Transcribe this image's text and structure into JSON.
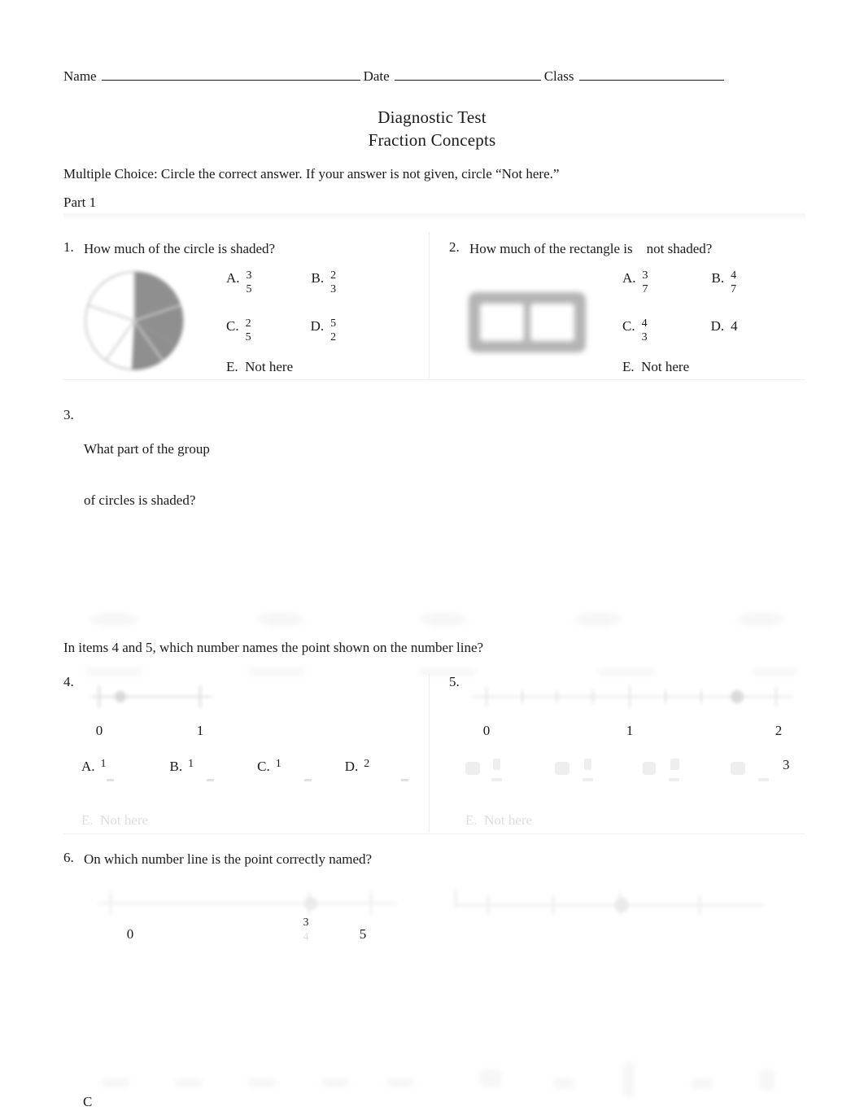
{
  "header": {
    "name_label": "Name",
    "date_label": "Date",
    "class_label": "Class"
  },
  "title": {
    "line1": "Diagnostic Test",
    "line2": "Fraction Concepts"
  },
  "instructions": "Multiple Choice: Circle the correct answer. If your answer is not given, circle “Not here.”",
  "part_label": "Part 1",
  "questions": [
    {
      "number": "1.",
      "text": "How much of the circle is shaded?",
      "figure": "circle-fifths-two-shaded",
      "choices": [
        {
          "letter": "A.",
          "num": "3",
          "den": "5"
        },
        {
          "letter": "B.",
          "num": "2",
          "den": "3"
        },
        {
          "letter": "C.",
          "num": "2",
          "den": "5"
        },
        {
          "letter": "D.",
          "num": "5",
          "den": "2"
        }
      ],
      "not_here": "E.  Not here"
    },
    {
      "number": "2.",
      "text": "How much of the rectangle is    not shaded?",
      "figure": "rectangle-two-cells",
      "choices": [
        {
          "letter": "A.",
          "num": "3",
          "den": "7"
        },
        {
          "letter": "B.",
          "num": "4",
          "den": "7"
        },
        {
          "letter": "C.",
          "num": "4",
          "den": "3"
        },
        {
          "letter": "D.",
          "num": "4",
          "den": ""
        }
      ],
      "not_here": "E.  Not here"
    },
    {
      "number": "3.",
      "text_line1": "What part of the group",
      "text_line2": "of circles is shaded?",
      "figure": "group-of-circles"
    }
  ],
  "numberline_prompt": "In items 4 and 5, which number names the point shown on the number line?",
  "question4": {
    "number": "4.",
    "axis_labels": [
      "0",
      "1"
    ],
    "choices": [
      {
        "letter": "A.",
        "num": "1",
        "den": ""
      },
      {
        "letter": "B.",
        "num": "1",
        "den": ""
      },
      {
        "letter": "C.",
        "num": "1",
        "den": ""
      },
      {
        "letter": "D.",
        "num": "2",
        "den": ""
      }
    ],
    "not_here": "E.  Not here"
  },
  "question5": {
    "number": "5.",
    "axis_labels": [
      "0",
      "1",
      "2"
    ],
    "choices": [
      {
        "letter": "",
        "num": "",
        "den": ""
      },
      {
        "letter": "",
        "num": "",
        "den": ""
      },
      {
        "letter": "",
        "num": "",
        "den": ""
      },
      {
        "letter": "",
        "num": "3",
        "den": ""
      }
    ],
    "not_here": "E.  Not here"
  },
  "question6": {
    "number": "6.",
    "text": "On which number line is the point correctly named?",
    "left_labels": {
      "zero": "0",
      "frac_num": "3",
      "frac_den": "4",
      "five": "5"
    }
  },
  "colors": {
    "ink": "#1a1a1a",
    "shade_gray": "#8c8c8c",
    "rule": "#1a1a1a"
  }
}
